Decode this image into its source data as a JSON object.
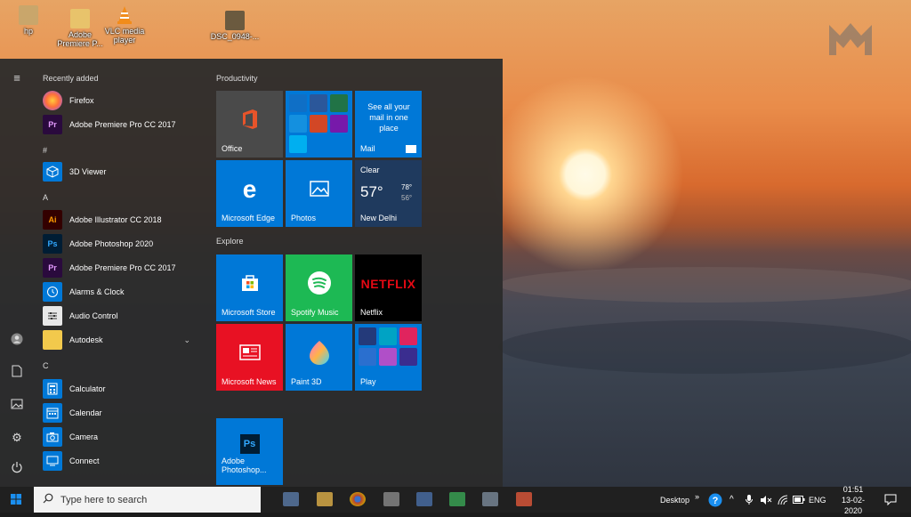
{
  "desktop": {
    "icons": [
      {
        "label": "hp"
      },
      {
        "label": "Adobe Premiere P..."
      },
      {
        "label": "VLC media player"
      },
      {
        "label": "DSC_0948-..."
      }
    ]
  },
  "start_menu": {
    "sections": {
      "recently_added": "Recently added",
      "hash": "#",
      "a": "A",
      "c": "C"
    },
    "apps": {
      "firefox": "Firefox",
      "premiere_recent": "Adobe Premiere Pro CC 2017",
      "viewer3d": "3D Viewer",
      "illustrator": "Adobe Illustrator CC 2018",
      "photoshop": "Adobe Photoshop 2020",
      "premiere": "Adobe Premiere Pro CC 2017",
      "alarms": "Alarms & Clock",
      "audio": "Audio Control",
      "autodesk": "Autodesk",
      "calculator": "Calculator",
      "calendar": "Calendar",
      "camera": "Camera",
      "connect": "Connect"
    },
    "groups": {
      "productivity": "Productivity",
      "explore": "Explore"
    },
    "tiles": {
      "office": "Office",
      "mail": "Mail",
      "mail_text": "See all your mail in one place",
      "weather_cond": "Clear",
      "weather_temp": "57°",
      "weather_hi": "78°",
      "weather_lo": "56°",
      "weather_city": "New Delhi",
      "edge": "Microsoft Edge",
      "photos": "Photos",
      "store": "Microsoft Store",
      "spotify": "Spotify Music",
      "netflix_logo": "NETFLIX",
      "netflix": "Netflix",
      "news": "Microsoft News",
      "paint3d": "Paint 3D",
      "play": "Play",
      "photoshop": "Adobe Photoshop...",
      "ps_logo": "Ps"
    }
  },
  "taskbar": {
    "search_placeholder": "Type here to search",
    "desktop_label": "Desktop",
    "toolbar_arrow": "»",
    "language": "ENG",
    "time": "01:51",
    "date": "13-02-2020"
  },
  "colors": {
    "tile_blue": "#0078d7",
    "tile_green": "#1db954",
    "tile_red": "#e81123",
    "start_bg": "#2b2b2b"
  }
}
